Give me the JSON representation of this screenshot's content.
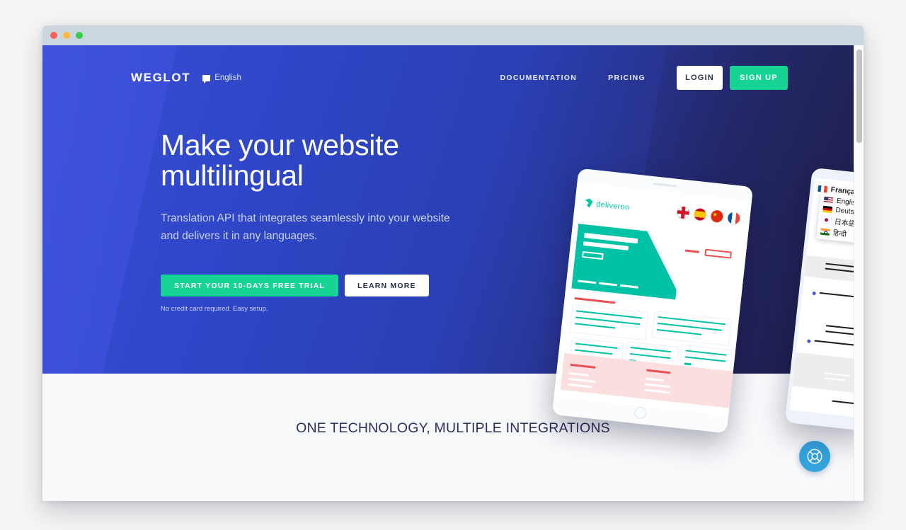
{
  "window": {
    "traffic_lights": [
      "close",
      "minimize",
      "maximize"
    ]
  },
  "nav": {
    "logo": "WEGLOT",
    "language_switcher": {
      "label": "English",
      "icon": "flag-icon"
    },
    "links": [
      {
        "label": "DOCUMENTATION"
      },
      {
        "label": "PRICING"
      }
    ],
    "login_label": "LOGIN",
    "signup_label": "SIGN UP"
  },
  "hero": {
    "title_line1": "Make your website",
    "title_line2": "multilingual",
    "subtitle_line1": "Translation API that integrates seamlessly into your website",
    "subtitle_line2": "and delivers it in any languages.",
    "cta_primary": "START YOUR 10-DAYS FREE TRIAL",
    "cta_secondary": "LEARN MORE",
    "cta_note": "No credit card required. Easy setup."
  },
  "tablet": {
    "brand": "deliveroo",
    "flags": [
      "uk-flag-icon",
      "spain-flag-icon",
      "china-flag-icon",
      "france-flag-icon"
    ]
  },
  "phone": {
    "selected_language": "Français",
    "dropdown_options": [
      {
        "label": "English",
        "flag": "us-flag-icon"
      },
      {
        "label": "Deutsch",
        "flag": "germany-flag-icon"
      },
      {
        "label": "日本語",
        "flag": "japan-flag-icon"
      },
      {
        "label": "हिन्दी",
        "flag": "india-flag-icon"
      }
    ]
  },
  "section": {
    "integrations_title": "ONE TECHNOLOGY, MULTIPLE INTEGRATIONS"
  },
  "support": {
    "icon": "lifebuoy-icon"
  },
  "colors": {
    "accent_green": "#17d496",
    "hero_blue": "#3b4fd6",
    "hero_navy": "#232550",
    "teal": "#00c2a6",
    "red": "#ea4f55",
    "support_blue": "#35a3dd",
    "heading_navy": "#2c2f5e"
  }
}
